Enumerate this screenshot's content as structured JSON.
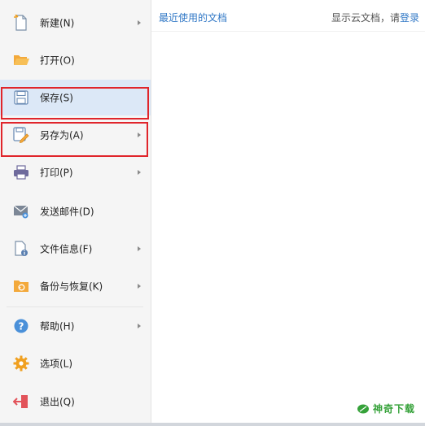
{
  "menu": {
    "items": [
      {
        "label": "新建(N)",
        "icon": "new-file-icon",
        "has_submenu": true
      },
      {
        "label": "打开(O)",
        "icon": "open-folder-icon",
        "has_submenu": false
      },
      {
        "label": "保存(S)",
        "icon": "save-icon",
        "has_submenu": false,
        "selected": true
      },
      {
        "label": "另存为(A)",
        "icon": "save-as-icon",
        "has_submenu": true
      },
      {
        "label": "打印(P)",
        "icon": "printer-icon",
        "has_submenu": true
      },
      {
        "label": "发送邮件(D)",
        "icon": "mail-icon",
        "has_submenu": false
      },
      {
        "label": "文件信息(F)",
        "icon": "file-info-icon",
        "has_submenu": true
      },
      {
        "label": "备份与恢复(K)",
        "icon": "backup-icon",
        "has_submenu": true
      },
      {
        "label": "帮助(H)",
        "icon": "help-icon",
        "has_submenu": true
      },
      {
        "label": "选项(L)",
        "icon": "gear-icon",
        "has_submenu": false
      },
      {
        "label": "退出(Q)",
        "icon": "exit-icon",
        "has_submenu": false
      }
    ]
  },
  "recent": {
    "title": "最近使用的文档",
    "cloud_hint": "显示云文档，请",
    "login_link": "登录"
  },
  "watermark": {
    "text": "神奇下载"
  },
  "colors": {
    "accent": "#3178c6",
    "highlight_box": "#e0252b",
    "selected_bg": "#dce8f7",
    "watermark_green": "#36a23a"
  }
}
